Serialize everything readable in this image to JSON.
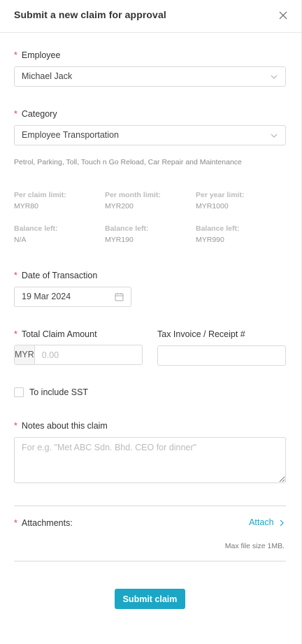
{
  "header": {
    "title": "Submit a new claim for approval",
    "close_icon": "close-icon"
  },
  "form": {
    "required_mark": "*",
    "employee": {
      "label": "Employee",
      "value": "Michael Jack"
    },
    "category": {
      "label": "Category",
      "value": "Employee Transportation",
      "hint": "Petrol, Parking, Toll, Touch n Go Reload, Car Repair and Maintenance"
    },
    "limits": [
      {
        "heading": "Per claim limit:",
        "value": "MYR80"
      },
      {
        "heading": "Per month limit:",
        "value": "MYR200"
      },
      {
        "heading": "Per year limit:",
        "value": "MYR1000"
      },
      {
        "heading": "Balance left:",
        "value": "N/A"
      },
      {
        "heading": "Balance left:",
        "value": "MYR190"
      },
      {
        "heading": "Balance left:",
        "value": "MYR990"
      }
    ],
    "date": {
      "label": "Date of Transaction",
      "value": "19 Mar 2024"
    },
    "amount": {
      "label": "Total Claim Amount",
      "currency": "MYR",
      "placeholder": "0.00"
    },
    "receipt": {
      "label": "Tax Invoice / Receipt #",
      "value": ""
    },
    "sst": {
      "label": "To include SST",
      "checked": false
    },
    "notes": {
      "label": "Notes about this claim",
      "placeholder": "For e.g. \"Met ABC Sdn. Bhd. CEO for dinner\""
    },
    "attachments": {
      "label": "Attachments:",
      "link_label": "Attach",
      "max_size": "Max file size 1MB."
    },
    "submit_label": "Submit claim"
  },
  "colors": {
    "accent": "#1ba6c5",
    "required": "#e54545"
  }
}
